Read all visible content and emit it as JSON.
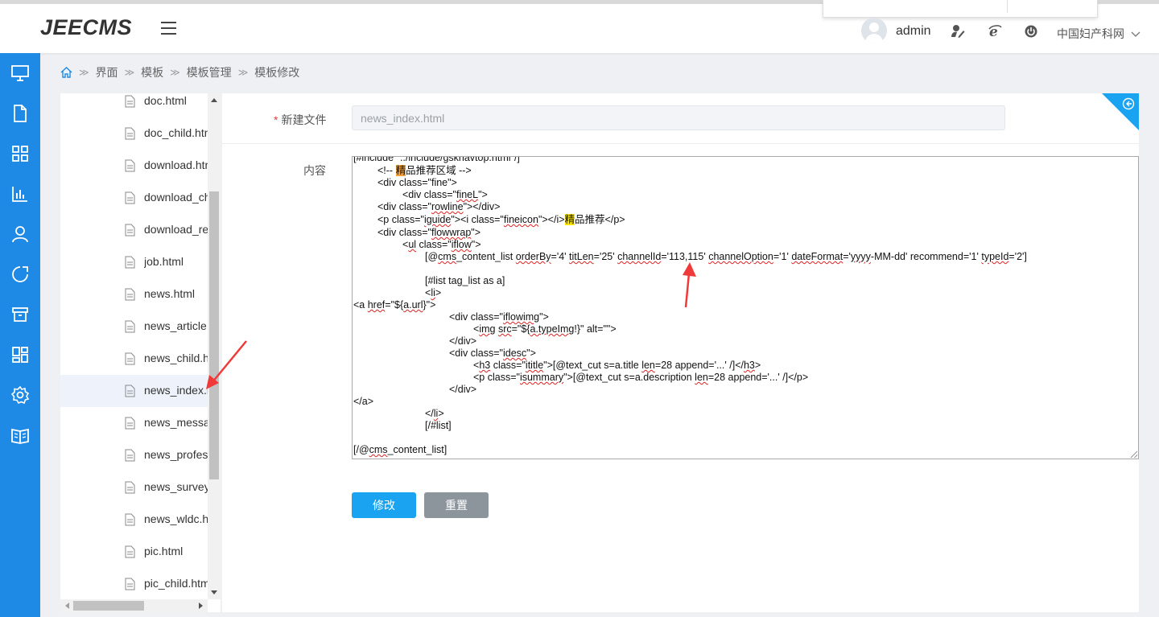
{
  "header": {
    "logo": "JEECMS",
    "username": "admin",
    "site": "中国妇产科网",
    "icons": [
      "menu-icon",
      "user-avatar",
      "edit-profile-icon",
      "browser-icon",
      "power-icon",
      "chevron-down-icon"
    ]
  },
  "breadcrumb": {
    "items": [
      "界面",
      "模板",
      "模板管理",
      "模板修改"
    ]
  },
  "file_tree": {
    "items": [
      {
        "name": "doc.html"
      },
      {
        "name": "doc_child.html"
      },
      {
        "name": "download.html"
      },
      {
        "name": "download_child.html"
      },
      {
        "name": "download_re.html"
      },
      {
        "name": "job.html"
      },
      {
        "name": "news.html"
      },
      {
        "name": "news_article.html"
      },
      {
        "name": "news_child.html"
      },
      {
        "name": "news_index.html"
      },
      {
        "name": "news_message.html"
      },
      {
        "name": "news_professor.html"
      },
      {
        "name": "news_survey.html"
      },
      {
        "name": "news_wldc.html"
      },
      {
        "name": "pic.html"
      },
      {
        "name": "pic_child.html"
      }
    ],
    "selected": "news_index.html"
  },
  "form": {
    "filename_label": "新建文件",
    "filename_value": "news_index.html",
    "content_label": "内容",
    "submit_label": "修改",
    "reset_label": "重置"
  },
  "editor": {
    "lines": [
      "[#include \"../include/gsknavtop.html\"/]",
      "<!-- 精品推荐区域 -->",
      "<div class=\"fine\">",
      "<div class=\"fineL\">",
      "<div class=\"rowline\"></div>",
      "<p class=\"iguide\"><i class=\"fineicon\"></i>精品推荐</p>",
      "<div class=\"flowwrap\">",
      "<ul class=\"iflow\">",
      "[@cms_content_list orderBy='4' titLen='25' channelId='113,115' channelOption='1' dateFormat='yyyy-MM-dd' recommend='1' typeId='2']",
      "[#list tag_list as a]",
      "<li>",
      "<a href=\"${a.url}\">",
      "<div class=\"iflowimg\">",
      "<img src=\"${a.typeImg!}\" alt=\"\">",
      "</div>",
      "<div class=\"idesc\">",
      "<h3 class=\"ititle\">[@text_cut s=a.title len=28 append='...' /]</h3>",
      "<p class=\"isummary\">[@text_cut s=a.description len=28 append='...' /]</p>",
      "</div>",
      "</a>",
      "</li>",
      "[/#list]",
      "[/@cms_content_list]"
    ]
  },
  "colors": {
    "sidebar": "#1f8ae6",
    "primary_button": "#1aa3f0",
    "reset_button": "#8c949c",
    "annotation_arrow": "#f03a3a"
  }
}
